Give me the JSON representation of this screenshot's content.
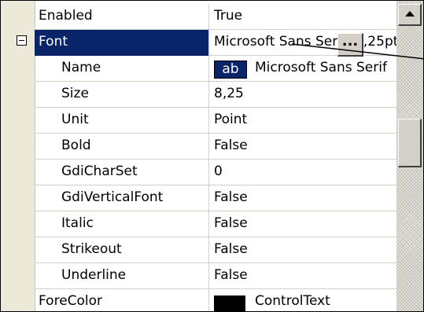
{
  "properties": {
    "enabled": {
      "name": "Enabled",
      "value": "True"
    },
    "font": {
      "name": "Font",
      "value": "Microsoft Sans Serif; 8,25pt",
      "ellipsis": "..."
    },
    "font_name": {
      "name": "Name",
      "preview": "ab",
      "value": "Microsoft Sans Serif"
    },
    "size": {
      "name": "Size",
      "value": "8,25"
    },
    "unit": {
      "name": "Unit",
      "value": "Point"
    },
    "bold": {
      "name": "Bold",
      "value": "False"
    },
    "gdicharset": {
      "name": "GdiCharSet",
      "value": "0"
    },
    "gdiverticalfont": {
      "name": "GdiVerticalFont",
      "value": "False"
    },
    "italic": {
      "name": "Italic",
      "value": "False"
    },
    "strikeout": {
      "name": "Strikeout",
      "value": "False"
    },
    "underline": {
      "name": "Underline",
      "value": "False"
    },
    "forecolor": {
      "name": "ForeColor",
      "value": "ControlText",
      "swatch_color": "#000000"
    }
  },
  "colors": {
    "selection": "#0a246a",
    "gutter": "#ece9d8",
    "grid_line": "#d4d0c8"
  },
  "icons": {
    "expander": "collapse-minus-icon",
    "scroll_up": "arrow-up-icon"
  }
}
